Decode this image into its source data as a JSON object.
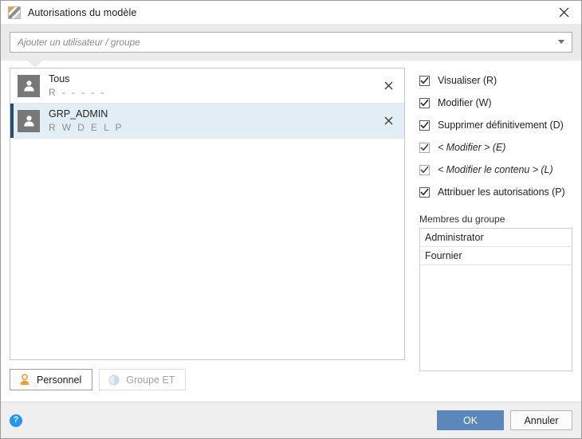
{
  "window": {
    "title": "Autorisations du modèle",
    "app_icon": "model-permissions-icon",
    "close_icon": "close-icon"
  },
  "search": {
    "placeholder": "Ajouter un utilisateur / groupe",
    "value": "",
    "dropdown_icon": "chevron-down-icon"
  },
  "principals": [
    {
      "name": "Tous",
      "permissions": "R - - - - -",
      "selected": false,
      "avatar_icon": "user-avatar-icon",
      "remove_icon": "close-icon"
    },
    {
      "name": "GRP_ADMIN",
      "permissions": "R W D E L P",
      "selected": true,
      "avatar_icon": "user-avatar-icon",
      "remove_icon": "close-icon"
    }
  ],
  "source_buttons": [
    {
      "label": "Personnel",
      "icon": "person-icon",
      "active": true
    },
    {
      "label": "Groupe ET",
      "icon": "group-circle-icon",
      "active": false
    }
  ],
  "permissions": [
    {
      "label": "Visualiser (R)",
      "checked": true,
      "italic": false
    },
    {
      "label": "Modifier (W)",
      "checked": true,
      "italic": false
    },
    {
      "label": "Supprimer définitivement (D)",
      "checked": true,
      "italic": false
    },
    {
      "label": "< Modifier > (E)",
      "checked": true,
      "italic": true
    },
    {
      "label": "< Modifier le contenu > (L)",
      "checked": true,
      "italic": true
    },
    {
      "label": "Attribuer les autorisations (P)",
      "checked": true,
      "italic": false
    }
  ],
  "members": {
    "title": "Membres du groupe",
    "rows": [
      "Administrator",
      "Fournier"
    ]
  },
  "footer": {
    "help_icon": "help-icon",
    "ok_label": "OK",
    "cancel_label": "Annuler"
  },
  "colors": {
    "accent_primary": "#5b87ba",
    "selection_bg": "#e2eef5",
    "selection_bar": "#1f4e79",
    "help_blue": "#2196f3",
    "person_orange": "#f0a030",
    "band_gray": "#eaeaea"
  }
}
